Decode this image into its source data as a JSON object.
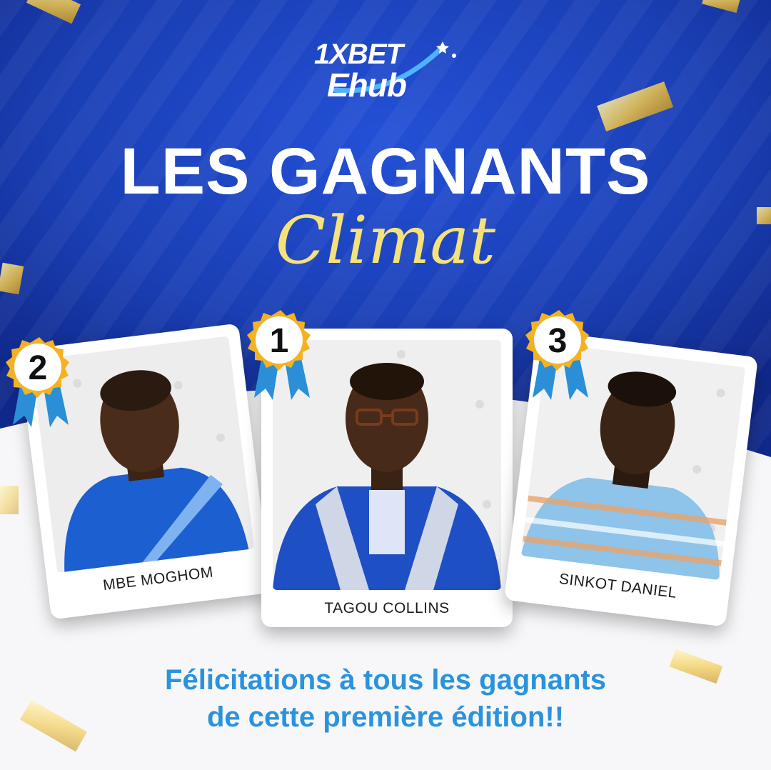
{
  "brand": {
    "logo_top": "1XBET",
    "logo_bottom": "Ehub"
  },
  "headline": {
    "title": "LES GAGNANTS",
    "subtitle": "Climat"
  },
  "winners": [
    {
      "rank": "1",
      "name": "TAGOU COLLINS"
    },
    {
      "rank": "2",
      "name": "MBE MOGHOM"
    },
    {
      "rank": "3",
      "name": "SINKOT DANIEL"
    }
  ],
  "footer": {
    "line1": "Félicitations à tous les gagnants",
    "line2": "de cette première édition!!"
  },
  "colors": {
    "background_blue": "#1a3fb5",
    "accent_yellow": "#f6e27a",
    "footer_blue": "#2a93dc",
    "medal_gold": "#f4b223",
    "ribbon_blue": "#2a8fd6"
  },
  "icons": [
    "gold-medal-icon",
    "ribbon-icon",
    "confetti-icon"
  ]
}
